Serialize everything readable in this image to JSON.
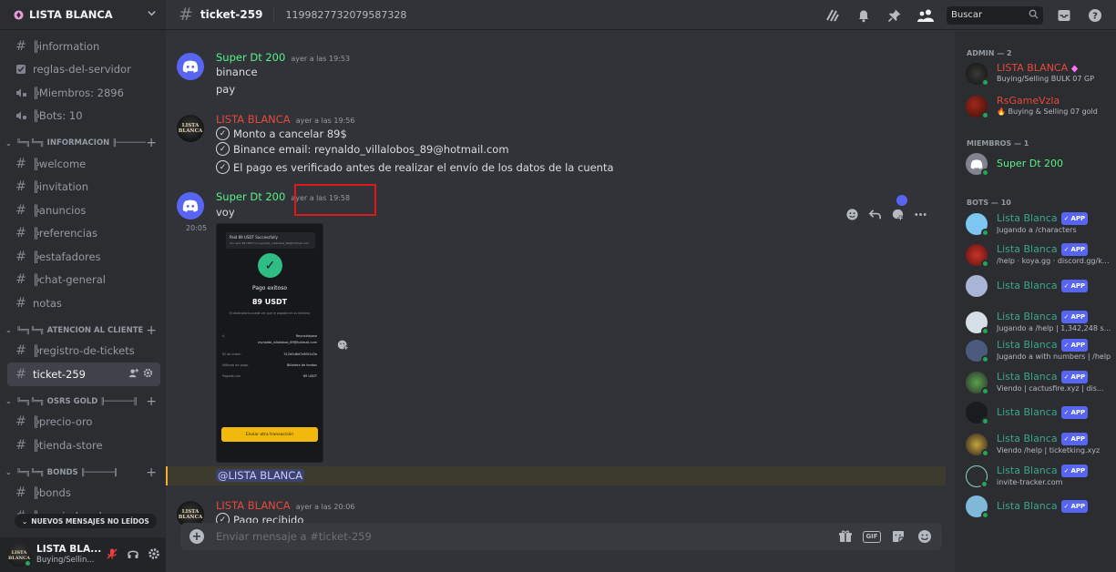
{
  "colors": {
    "accent": "#5865f2",
    "online": "#23a55a",
    "admin_red": "#e8483b",
    "bot_green": "#3ba58d",
    "mention_bg": "#3d3a2e",
    "highlight_box": "#e0171b"
  },
  "server": {
    "name": "LISTA BLANCA"
  },
  "channels": {
    "top": [
      {
        "icon": "hash",
        "label": "╠information"
      },
      {
        "icon": "rules",
        "label": "reglas-del-servidor"
      },
      {
        "icon": "voice",
        "label": "╠Miembros: 2896"
      },
      {
        "icon": "voice",
        "label": "╠Bots: 10"
      }
    ],
    "cat_info": {
      "label": "╚═╗╚═╗ INFORMACION ╟──────╢"
    },
    "info": [
      "╠welcome",
      "╠invitation",
      "╠anuncios",
      "╠referencias",
      "╠estafadores",
      "╠chat-general",
      "notas"
    ],
    "cat_atencion": {
      "label": "╚═╗╚═╗ ATENCIÓN AL CLIENTE ╟..."
    },
    "atencion": [
      "╠registro-de-tickets",
      "ticket-259"
    ],
    "cat_osrs": {
      "label": "╚═╗╚═╗ OSRS GOLD ╟──────╢"
    },
    "osrs": [
      "╠precio-oro",
      "╠tienda-store"
    ],
    "cat_bonds": {
      "label": "╚═╗╚═╗ BONDS ╟──────╢"
    },
    "bonds": [
      "╠bonds",
      "╠precio-bonds"
    ]
  },
  "unread_pill": "NUEVOS MENSAJES NO LEÍDOS",
  "user": {
    "name": "LISTA BLA...",
    "status": "Buying/Sellin..."
  },
  "header": {
    "channel": "ticket-259",
    "topic": "1199827732079587328",
    "search_placeholder": "Buscar"
  },
  "messages": {
    "m1": {
      "author": "Super Dt 200",
      "time": "ayer a las 19:53",
      "lines": [
        "binance",
        "pay"
      ]
    },
    "m2": {
      "author": "LISTA BLANCA",
      "time": "ayer a las 19:56",
      "lines": [
        "Monto a cancelar 89$",
        "Binance email: reynaldo_villalobos_89@hotmail.com",
        "El pago es verificado antes de realizar el envío de los datos de la cuenta"
      ]
    },
    "m3": {
      "author": "Super Dt 200",
      "time": "ayer a las 19:58",
      "lines": [
        "voy"
      ],
      "side_time": "20:05"
    },
    "mention": "@LISTA BLANCA",
    "m4": {
      "author": "LISTA BLANCA",
      "time": "ayer a las 20:06",
      "lines": [
        "Pago recibido"
      ]
    }
  },
  "payment_image": {
    "header": "Paid 89 USDT Successfully",
    "subheader": "You sent 89 USDT to reynaldo_villalobos_89@hotmail.com",
    "title": "Pago exitoso",
    "amount": "89 USDT",
    "note": "El destinatario puede ver que le pagaste en su billetera",
    "rows": [
      {
        "k": "A",
        "v": "Reynaldojose"
      },
      {
        "k": "",
        "v": "reynaldo_villalobos_89@hotmail.com"
      },
      {
        "k": "ID de orden",
        "v": "312d5d8d7e85f1d3a"
      },
      {
        "k": "Método de pago",
        "v": "Billetera de fondos"
      },
      {
        "k": "Pagado con",
        "v": "89 USDT"
      }
    ],
    "button": "Enviar otra transacción"
  },
  "composer": {
    "placeholder": "Enviar mensaje a #ticket-259",
    "gif": "GIF"
  },
  "members": {
    "admin_header": "ADMIN — 2",
    "admins": [
      {
        "name": "LISTA BLANCA",
        "sub": "Buying/Selling BULK 07 GP"
      },
      {
        "name": "RsGameVzla",
        "sub": "Buying & Selling 07 gold"
      }
    ],
    "members_header": "MIEMBROS — 1",
    "members": [
      {
        "name": "Super Dt 200"
      }
    ],
    "bots_header": "BOTS — 10",
    "app_label": "APP",
    "bots": [
      {
        "name": "Lista Blanca",
        "sub": "Jugando a /characters"
      },
      {
        "name": "Lista Blanca",
        "sub": "/help · koya.gg · discord.gg/ko..."
      },
      {
        "name": "Lista Blanca",
        "sub": ""
      },
      {
        "name": "Lista Blanca",
        "sub": "Jugando a /help | 1,342,248 s..."
      },
      {
        "name": "Lista Blanca",
        "sub": "Jugando a with numbers | /help"
      },
      {
        "name": "Lista Blanca",
        "sub": "Viendo  | cactusfire.xyz | dis..."
      },
      {
        "name": "Lista Blanca",
        "sub": ""
      },
      {
        "name": "Lista Blanca",
        "sub": "Viendo /help | ticketking.xyz"
      },
      {
        "name": "Lista Blanca",
        "sub": " invite-tracker.com"
      },
      {
        "name": "Lista Blanca",
        "sub": ""
      }
    ]
  }
}
